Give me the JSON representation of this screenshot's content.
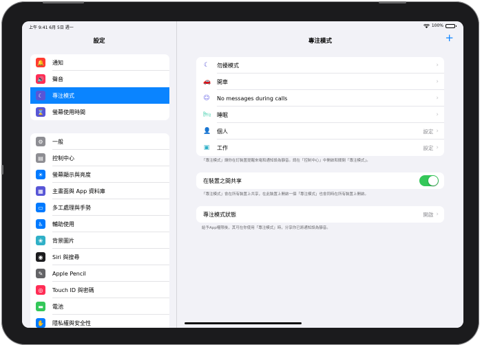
{
  "status_bar": {
    "time_date": "上午 9:41   6月 5日 週一",
    "battery": "100%"
  },
  "sidebar": {
    "title": "設定",
    "group1": [
      {
        "label": "通知",
        "icon": "bell-icon",
        "color": "#ff3b30",
        "glyph": "🔔"
      },
      {
        "label": "聲音",
        "icon": "speaker-icon",
        "color": "#ff2d55",
        "glyph": "🔊"
      },
      {
        "label": "專注模式",
        "icon": "moon-icon",
        "color": "#5856d6",
        "glyph": "☾",
        "selected": true
      },
      {
        "label": "螢幕使用時間",
        "icon": "hourglass-icon",
        "color": "#5856d6",
        "glyph": "⌛"
      }
    ],
    "group2": [
      {
        "label": "一般",
        "icon": "gear-icon",
        "color": "#8e8e93",
        "glyph": "⚙"
      },
      {
        "label": "控制中心",
        "icon": "control-center-icon",
        "color": "#8e8e93",
        "glyph": "▤"
      },
      {
        "label": "螢幕顯示與亮度",
        "icon": "brightness-icon",
        "color": "#007aff",
        "glyph": "☀"
      },
      {
        "label": "主畫面與 App 資料庫",
        "icon": "home-screen-icon",
        "color": "#5856d6",
        "glyph": "▦"
      },
      {
        "label": "多工處理與手勢",
        "icon": "multitasking-icon",
        "color": "#007aff",
        "glyph": "▭"
      },
      {
        "label": "輔助使用",
        "icon": "accessibility-icon",
        "color": "#007aff",
        "glyph": "♿"
      },
      {
        "label": "背景圖片",
        "icon": "wallpaper-icon",
        "color": "#30b0c7",
        "glyph": "❀"
      },
      {
        "label": "Siri 與搜尋",
        "icon": "siri-icon",
        "color": "#1c1c1e",
        "glyph": "◉"
      },
      {
        "label": "Apple Pencil",
        "icon": "pencil-icon",
        "color": "#636366",
        "glyph": "✎"
      },
      {
        "label": "Touch ID 與密碼",
        "icon": "fingerprint-icon",
        "color": "#ff2d55",
        "glyph": "◎"
      },
      {
        "label": "電池",
        "icon": "battery-icon",
        "color": "#34c759",
        "glyph": "▬"
      },
      {
        "label": "隱私權與安全性",
        "icon": "hand-icon",
        "color": "#007aff",
        "glyph": "✋"
      }
    ]
  },
  "detail": {
    "title": "專注模式",
    "add_label": "+",
    "modes": [
      {
        "label": "勿擾模式",
        "icon": "moon-icon",
        "color": "#5856d6",
        "glyph": "☾",
        "value": ""
      },
      {
        "label": "開車",
        "icon": "car-icon",
        "color": "#0a84ff",
        "glyph": "🚗",
        "value": ""
      },
      {
        "label": "No messages during calls",
        "icon": "smiley-icon",
        "color": "#5e5ce6",
        "glyph": "☺",
        "value": ""
      },
      {
        "label": "睡眠",
        "icon": "bed-icon",
        "color": "#30c9a6",
        "glyph": "🛏",
        "value": ""
      },
      {
        "label": "個人",
        "icon": "person-icon",
        "color": "#af52de",
        "glyph": "👤",
        "value": "設定"
      },
      {
        "label": "工作",
        "icon": "id-badge-icon",
        "color": "#30b0c7",
        "glyph": "▣",
        "value": "設定"
      }
    ],
    "modes_footnote": "「專注模式」讓你在訂裝置提醒來電和通知設為靜音。請在「控制中心」中開啟和關閉「專注模式」。",
    "share_label": "在裝置之間共享",
    "share_on": true,
    "share_footnote": "「專注模式」會在所有裝置上共享，在此裝置上開啟一個「專注模式」也會同時在所有裝置上開啟。",
    "status_label": "專注模式狀態",
    "status_value": "開啟",
    "status_footnote": "給予App權限後，其可在你使用「專注模式」時，分享你已將通知設為靜音。"
  }
}
